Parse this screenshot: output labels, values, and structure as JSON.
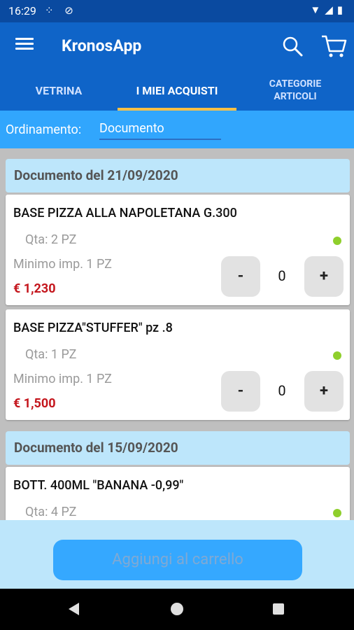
{
  "status": {
    "time": "16:29"
  },
  "appbar": {
    "title": "KronosApp"
  },
  "tabs": {
    "vetrina": "VETRINA",
    "acquisti": "I MIEI ACQUISTI",
    "categorie": "CATEGORIE ARTICOLI"
  },
  "sort": {
    "label": "Ordinamento:",
    "value": "Documento"
  },
  "groups": [
    {
      "header": "Documento del 21/09/2020",
      "items": [
        {
          "name": "BASE PIZZA ALLA NAPOLETANA G.300",
          "qty": "Qta:  2 PZ",
          "min": "Minimo imp. 1 PZ",
          "price": "€ 1,230",
          "count": "0"
        },
        {
          "name": "BASE PIZZA\"STUFFER\" pz .8",
          "qty": "Qta:  1 PZ",
          "min": "Minimo imp. 1 PZ",
          "price": "€ 1,500",
          "count": "0"
        }
      ]
    },
    {
      "header": "Documento del 15/09/2020",
      "items": [
        {
          "name": "BOTT. 400ML \"BANANA  -0,99\"",
          "qty": "Qta:  4 PZ"
        }
      ]
    }
  ],
  "buttons": {
    "minus": "-",
    "plus": "+"
  },
  "footer": {
    "add_to_cart": "Aggiungi al carrello"
  }
}
